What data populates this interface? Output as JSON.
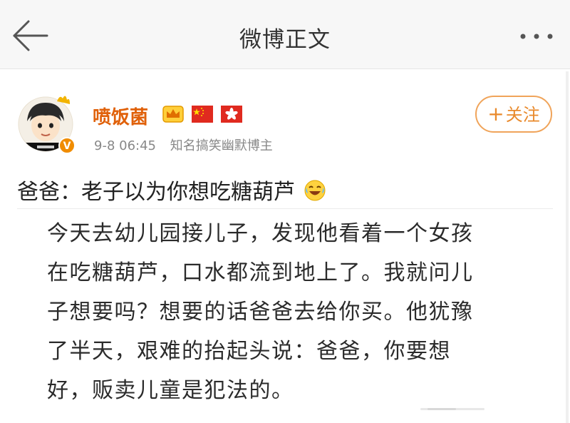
{
  "navbar": {
    "title": "微博正文"
  },
  "post": {
    "author": "喷饭菌",
    "time": "9-8 06:45",
    "author_desc": "知名搞笑幽默博主",
    "follow_label": "关注",
    "title": "爸爸：老子以为你想吃糖葫芦",
    "body_lines": [
      "今天去幼儿园接儿子，发现他看着一个女孩",
      "在吃糖葫芦，口水都流到地上了。我就问儿",
      "子想要吗？想要的话爸爸去给你买。他犹豫",
      "了半天，艰难的抬起头说：爸爸，你要想",
      "好，贩卖儿童是犯法的。"
    ]
  },
  "icons": {
    "back": "arrow-left-icon",
    "more": "more-dots-icon",
    "crown": "crown-badge-icon",
    "flag1": "china-flag-icon",
    "flag2": "hongkong-flag-icon",
    "emoji": "laugh-cry-emoji-icon",
    "verified": "verified-v-icon"
  },
  "colors": {
    "username": "#e0610a",
    "follow": "#e98a2c",
    "navbar_bg": "#f7f7f7"
  }
}
